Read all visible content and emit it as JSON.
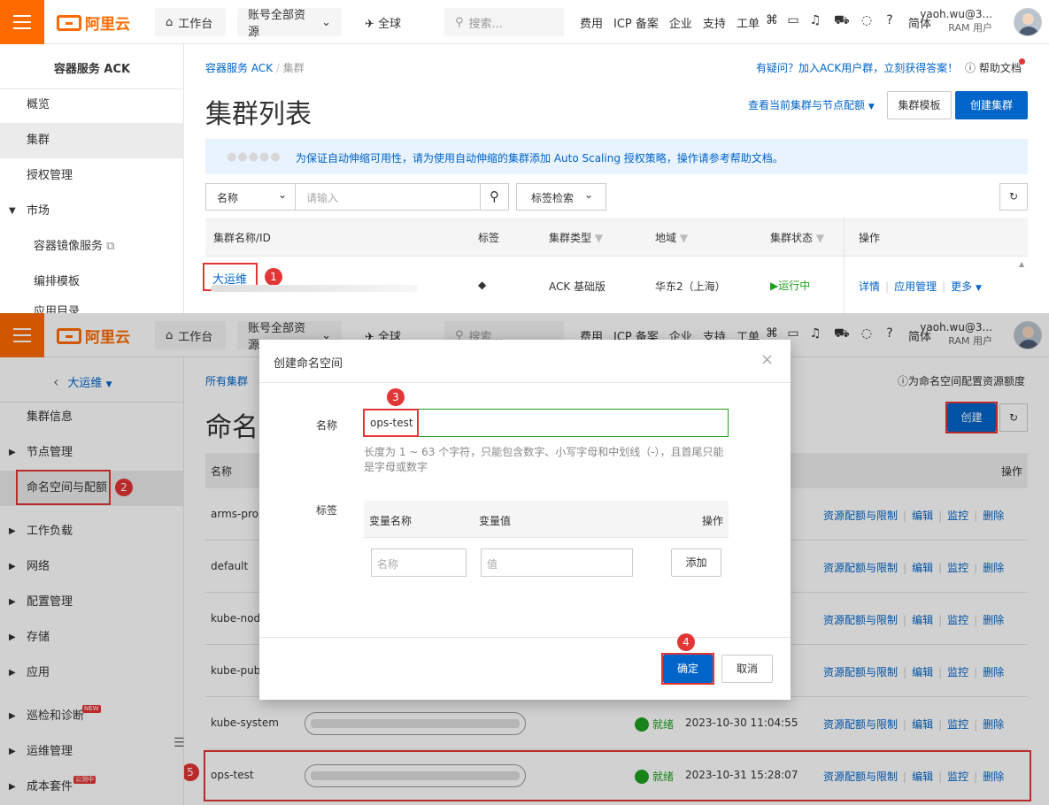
{
  "topbar": {
    "logo_text": "阿里云",
    "workbench": "工作台",
    "resources": "账号全部资源",
    "region": "全球",
    "search_placeholder": "搜索...",
    "links": [
      "费用",
      "ICP 备案",
      "企业",
      "支持",
      "工单"
    ],
    "lang": "简体",
    "user_name": "yaoh.wu@3...",
    "user_role": "RAM 用户"
  },
  "top": {
    "sidebar_title": "容器服务 ACK",
    "sidebar_items": [
      "概览",
      "集群",
      "授权管理",
      "市场",
      "容器镜像服务",
      "编排模板",
      "应用目录"
    ],
    "breadcrumb": [
      "容器服务 ACK",
      "集群"
    ],
    "help_text": "有疑问？加入ACK用户群，立刻获得答案！",
    "help_doc": "帮助文档",
    "page_title": "集群列表",
    "quota_link": "查看当前集群与节点配额",
    "template_btn": "集群模板",
    "create_btn": "创建集群",
    "notice": "为保证自动伸缩可用性，请为使用自动伸缩的集群添加 Auto Scaling 授权策略，操作请参考帮助文档。",
    "filter_select": "名称",
    "filter_placeholder": "请输入",
    "tag_search": "标签检索",
    "columns": [
      "集群名称/ID",
      "标签",
      "集群类型",
      "地域",
      "集群状态",
      "操作"
    ],
    "row": {
      "name": "大运维",
      "type": "ACK 基础版",
      "region": "华东2（上海）",
      "status": "运行中",
      "actions": [
        "详情",
        "应用管理",
        "更多"
      ]
    },
    "step1": "1"
  },
  "bottom": {
    "cluster_select": "大运维",
    "sidebar_items": [
      "集群信息",
      "节点管理",
      "命名空间与配额",
      "工作负载",
      "网络",
      "配置管理",
      "存储",
      "应用",
      "巡检和诊断",
      "运维管理",
      "成本套件"
    ],
    "new_badge": "NEW",
    "beta_badge": "公测中",
    "breadcrumb": "所有集群",
    "quota_help": "为命名空间配置资源额度",
    "page_title": "命名空",
    "create_btn": "创建",
    "col_name": "名称",
    "col_ops": "操作",
    "namespaces": [
      {
        "name": "arms-prom",
        "status": "",
        "time": ""
      },
      {
        "name": "default",
        "status": "",
        "time": ""
      },
      {
        "name": "kube-node",
        "status": "",
        "time": ""
      },
      {
        "name": "kube-publ",
        "status": "",
        "time": ""
      },
      {
        "name": "kube-system",
        "status": "就绪",
        "time": "2023-10-30 11:04:55"
      },
      {
        "name": "ops-test",
        "status": "就绪",
        "time": "2023-10-31 15:28:07"
      }
    ],
    "row_actions": [
      "资源配额与限制",
      "编辑",
      "监控",
      "删除"
    ],
    "steps": [
      "2",
      "5"
    ]
  },
  "modal": {
    "title": "创建命名空间",
    "name_label": "名称",
    "name_value": "ops-test",
    "hint": "长度为 1 ~ 63 个字符，只能包含数字、小写字母和中划线（-），且首尾只能是字母或数字",
    "tag_label": "标签",
    "tag_cols": [
      "变量名称",
      "变量值",
      "操作"
    ],
    "tag_name_placeholder": "名称",
    "tag_value_placeholder": "值",
    "add_btn": "添加",
    "ok_btn": "确定",
    "cancel_btn": "取消",
    "steps": [
      "3",
      "4"
    ]
  },
  "colors": {
    "accent": "#ff6a00",
    "primary": "#0064c8",
    "highlight": "#e23535",
    "success": "#1ea01e"
  }
}
